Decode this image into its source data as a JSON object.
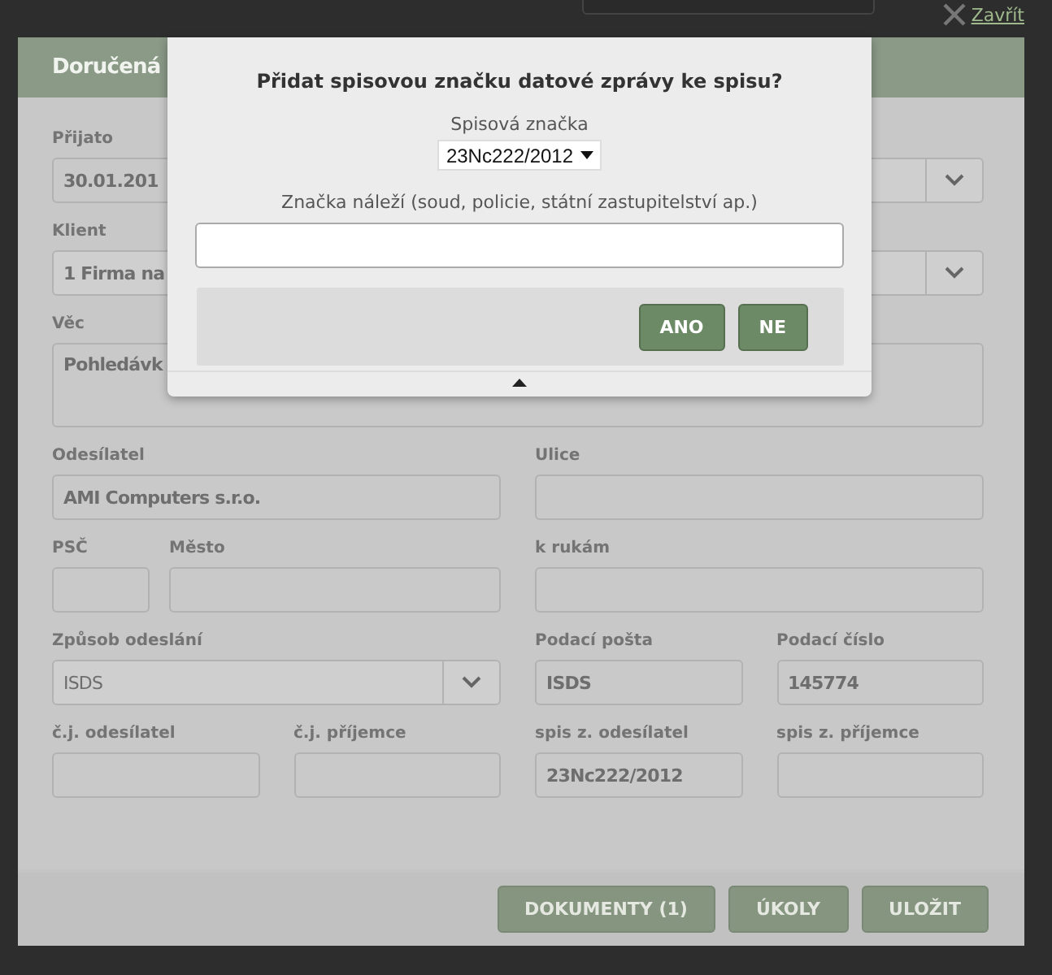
{
  "close_link": {
    "label": "Zavřít"
  },
  "modal": {
    "title": "Doručená",
    "fields": [
      {
        "kind": "input",
        "label": "Přijato",
        "value": "30.01.201"
      },
      {
        "kind": "select"
      },
      {
        "kind": "select",
        "label": "Klient",
        "value": "1 Firma na"
      },
      {
        "kind": "textarea",
        "label": "Věc",
        "value": "Pohledávk"
      },
      {
        "kind": "input",
        "label": "Odesílatel",
        "value": "AMI Computers  s.r.o."
      },
      {
        "kind": "input",
        "label": "Ulice"
      },
      {
        "kind": "input",
        "label": "PSČ"
      },
      {
        "kind": "input",
        "label": "Město"
      },
      {
        "kind": "input",
        "label": "k rukám"
      },
      {
        "kind": "select",
        "label": "Způsob odeslání",
        "value": "ISDS"
      },
      {
        "kind": "input",
        "label": "Podací pošta",
        "value": "ISDS"
      },
      {
        "kind": "input",
        "label": "Podací číslo",
        "value": "145774"
      },
      {
        "kind": "input",
        "label": "č.j. odesílatel"
      },
      {
        "kind": "input",
        "label": "č.j. příjemce"
      },
      {
        "kind": "input",
        "label": "spis z. odesílatel",
        "value": "23Nc222/2012"
      },
      {
        "kind": "input",
        "label": "spis z. příjemce"
      }
    ],
    "buttons": [
      "DOKUMENTY (1)",
      "ÚKOLY",
      "ULOŽIT"
    ]
  },
  "dialog": {
    "title": "Přidat spisovou značku datové zprávy ke spisu?",
    "select_label": "Spisová značka",
    "select_value": "23Nc222/2012",
    "input_label": "Značka náleží (soud, policie, státní zastupitelství ap.)",
    "buttons": [
      "ANO",
      "NE"
    ]
  }
}
